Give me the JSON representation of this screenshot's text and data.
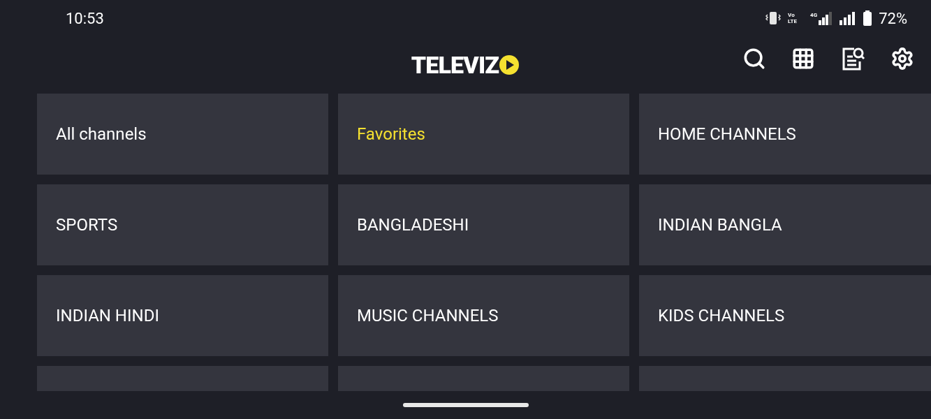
{
  "status_bar": {
    "time": "10:53",
    "volte_label": "Vo LTE",
    "network_label": "4G",
    "battery": "72%"
  },
  "app_bar": {
    "logo": "TELEVIZ"
  },
  "categories": [
    {
      "kind": "tile",
      "label": "All channels",
      "selected": false
    },
    {
      "kind": "tile",
      "label": "Favorites",
      "selected": true
    },
    {
      "kind": "tile",
      "label": "HOME CHANNELS",
      "selected": false
    },
    {
      "kind": "tile",
      "label": "SPORTS",
      "selected": false
    },
    {
      "kind": "tile",
      "label": "BANGLADESHI",
      "selected": false
    },
    {
      "kind": "tile",
      "label": "INDIAN BANGLA",
      "selected": false
    },
    {
      "kind": "tile",
      "label": "INDIAN HINDI",
      "selected": false
    },
    {
      "kind": "tile",
      "label": "MUSIC CHANNELS",
      "selected": false
    },
    {
      "kind": "tile",
      "label": "KIDS CHANNELS",
      "selected": false
    },
    {
      "kind": "cut"
    },
    {
      "kind": "cut"
    },
    {
      "kind": "cut"
    }
  ]
}
